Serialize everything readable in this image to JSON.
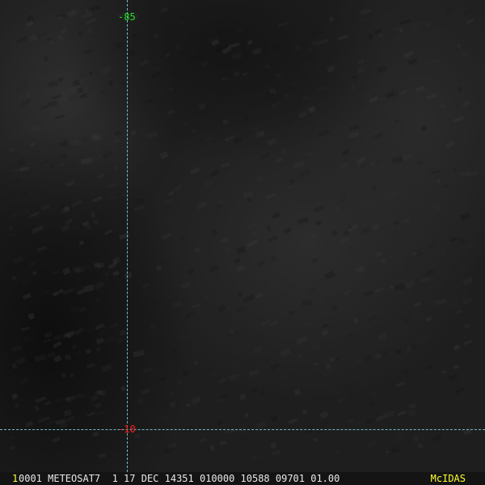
{
  "grid": {
    "longitude_label": "-85",
    "latitude_label": "-10",
    "longitude_label_color": "#22e022",
    "latitude_label_color": "#ff2020",
    "line_color": "#7fd8e6"
  },
  "status_bar": {
    "frame_number": "1",
    "text": "0001 METEOSAT7  1 17 DEC 14351 010000 10588 09701 01.00",
    "brand": "McIDAS"
  }
}
